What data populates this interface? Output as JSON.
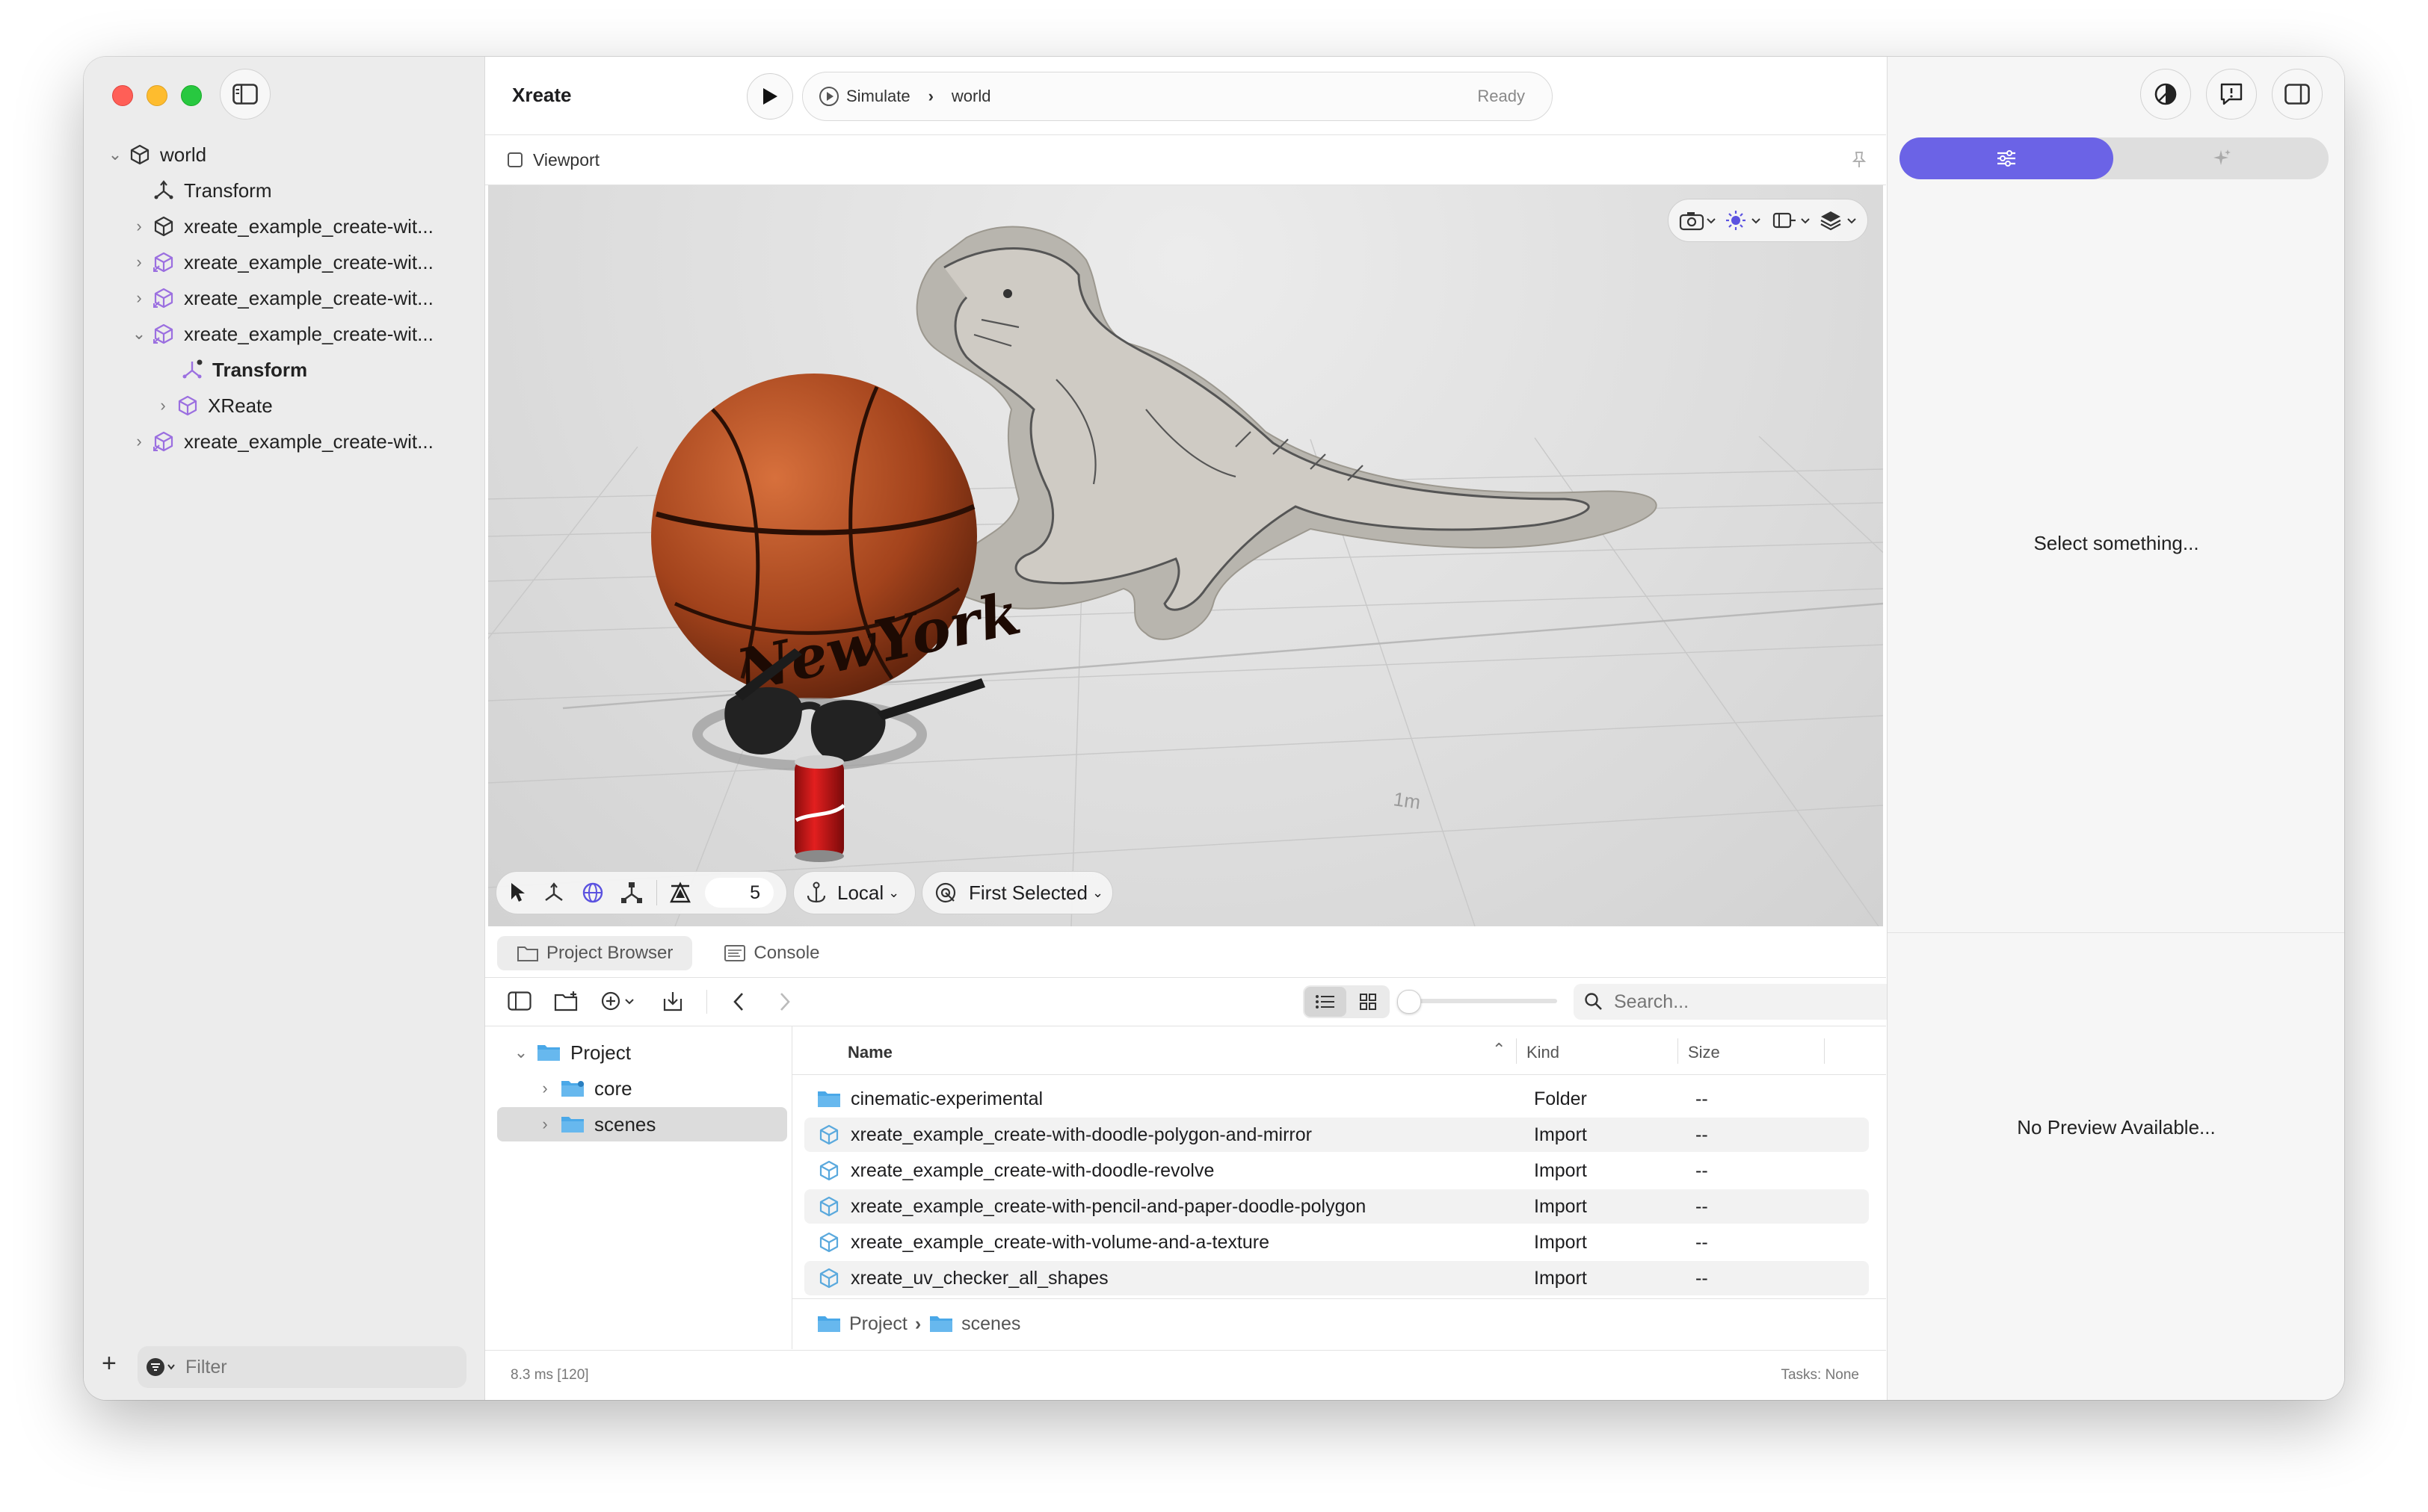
{
  "sidebar": {
    "tree": [
      {
        "label": "world",
        "indent": 0,
        "icon": "cube-icon",
        "expanded": true
      },
      {
        "label": "Transform",
        "indent": 1,
        "icon": "transform-icon"
      },
      {
        "label": "xreate_example_create-wit...",
        "indent": 1,
        "icon": "cube-icon",
        "expanded": false
      },
      {
        "label": "xreate_example_create-wit...",
        "indent": 1,
        "icon": "import-cube-icon",
        "expanded": false
      },
      {
        "label": "xreate_example_create-wit...",
        "indent": 1,
        "icon": "import-cube-icon",
        "expanded": false
      },
      {
        "label": "xreate_example_create-wit...",
        "indent": 1,
        "icon": "import-cube-icon",
        "expanded": true
      },
      {
        "label": "Transform",
        "indent": 2,
        "icon": "transform-icon",
        "bold": true
      },
      {
        "label": "XReate",
        "indent": 2,
        "icon": "cube-icon",
        "expanded": false
      },
      {
        "label": "xreate_example_create-wit...",
        "indent": 1,
        "icon": "import-cube-icon",
        "expanded": false
      }
    ],
    "filter_placeholder": "Filter"
  },
  "toolbar": {
    "app_title": "Xreate",
    "simulate_label": "Simulate",
    "scene_name": "world",
    "status": "Ready"
  },
  "viewport": {
    "header_label": "Viewport",
    "grid_label": "1m",
    "snap_value": "5",
    "space_label": "Local",
    "pivot_label": "First Selected"
  },
  "panels": {
    "tabs": [
      {
        "label": "Project Browser",
        "active": true
      },
      {
        "label": "Console",
        "active": false
      }
    ]
  },
  "browser": {
    "search_placeholder": "Search...",
    "tree": [
      {
        "label": "Project",
        "indent": 0,
        "expanded": true
      },
      {
        "label": "core",
        "indent": 1,
        "expanded": false
      },
      {
        "label": "scenes",
        "indent": 1,
        "expanded": false,
        "selected": true
      }
    ],
    "columns": {
      "name": "Name",
      "kind": "Kind",
      "size": "Size"
    },
    "files": [
      {
        "name": "cinematic-experimental",
        "kind": "Folder",
        "size": "--",
        "icon": "folder-icon"
      },
      {
        "name": "xreate_example_create-with-doodle-polygon-and-mirror",
        "kind": "Import",
        "size": "--",
        "icon": "import-cube-icon"
      },
      {
        "name": "xreate_example_create-with-doodle-revolve",
        "kind": "Import",
        "size": "--",
        "icon": "import-cube-icon"
      },
      {
        "name": "xreate_example_create-with-pencil-and-paper-doodle-polygon",
        "kind": "Import",
        "size": "--",
        "icon": "import-cube-icon"
      },
      {
        "name": "xreate_example_create-with-volume-and-a-texture",
        "kind": "Import",
        "size": "--",
        "icon": "import-cube-icon"
      },
      {
        "name": "xreate_uv_checker_all_shapes",
        "kind": "Import",
        "size": "--",
        "icon": "import-cube-icon"
      }
    ],
    "path": [
      "Project",
      "scenes"
    ]
  },
  "status_bar": {
    "frame_time": "8.3 ms [120]",
    "tasks": "Tasks: None"
  },
  "inspector": {
    "empty_message": "Select something...",
    "preview_message": "No Preview Available..."
  },
  "colors": {
    "accent": "#6b63e6",
    "folder": "#4aa8e8",
    "import": "#5aa9dd"
  }
}
